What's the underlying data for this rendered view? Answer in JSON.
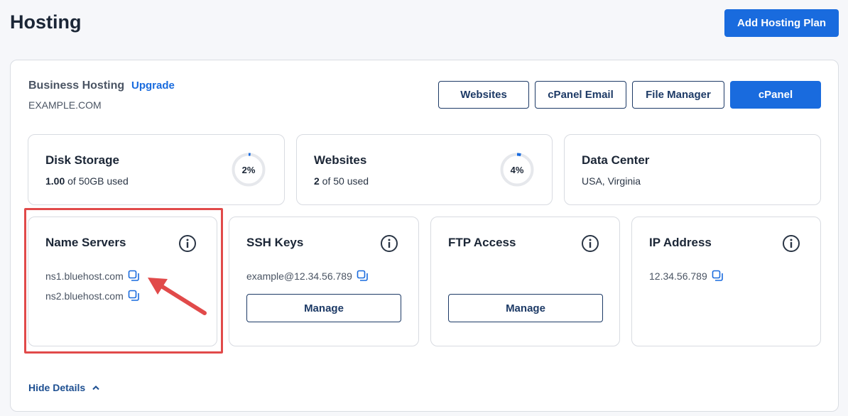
{
  "page": {
    "title": "Hosting",
    "add_plan_label": "Add Hosting Plan"
  },
  "plan": {
    "name": "Business Hosting",
    "upgrade_label": "Upgrade",
    "domain": "EXAMPLE.COM",
    "buttons": {
      "websites": "Websites",
      "cpanel_email": "cPanel Email",
      "file_manager": "File Manager",
      "cpanel": "cPanel"
    }
  },
  "stats": {
    "disk": {
      "title": "Disk Storage",
      "used": "1.00",
      "rest": " of 50GB used",
      "percent_label": "2%",
      "percent": 2
    },
    "websites": {
      "title": "Websites",
      "used": "2",
      "rest": " of 50 used",
      "percent_label": "4%",
      "percent": 4
    },
    "datacenter": {
      "title": "Data Center",
      "location": "USA, Virginia"
    }
  },
  "details": {
    "name_servers": {
      "title": "Name Servers",
      "ns1": "ns1.bluehost.com",
      "ns2": "ns2.bluehost.com"
    },
    "ssh": {
      "title": "SSH Keys",
      "value": "example@12.34.56.789",
      "manage_label": "Manage"
    },
    "ftp": {
      "title": "FTP Access",
      "manage_label": "Manage"
    },
    "ip": {
      "title": "IP Address",
      "value": "12.34.56.789"
    }
  },
  "footer": {
    "hide_details_label": "Hide Details"
  },
  "colors": {
    "primary": "#196bde",
    "outline": "#1d3a66",
    "highlight": "#e14a4a",
    "ring_track": "#e6e8ec"
  }
}
